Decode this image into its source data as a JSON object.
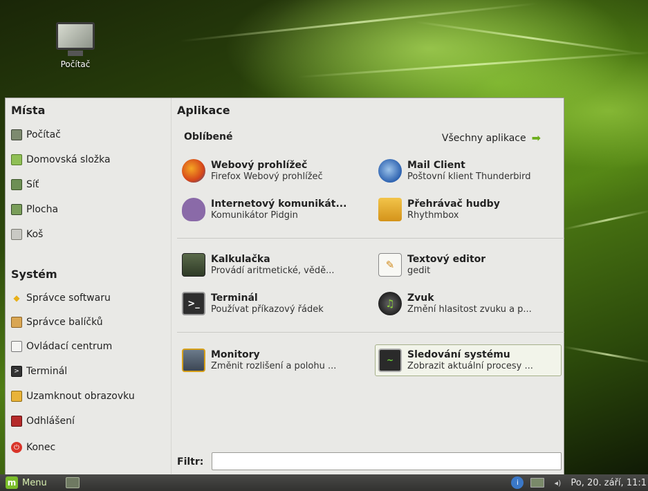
{
  "desktop": {
    "icon_label": "Počítač"
  },
  "places": {
    "title": "Místa",
    "items": [
      {
        "label": "Počítač",
        "icon": "computer-icon"
      },
      {
        "label": "Domovská složka",
        "icon": "home-folder-icon"
      },
      {
        "label": "Síť",
        "icon": "network-icon"
      },
      {
        "label": "Plocha",
        "icon": "desktop-icon"
      },
      {
        "label": "Koš",
        "icon": "trash-icon"
      }
    ]
  },
  "system": {
    "title": "Systém",
    "items": [
      {
        "label": "Správce softwaru",
        "icon": "software-manager-icon"
      },
      {
        "label": "Správce balíčků",
        "icon": "package-manager-icon"
      },
      {
        "label": "Ovládací centrum",
        "icon": "control-center-icon"
      },
      {
        "label": "Terminál",
        "icon": "terminal-icon"
      },
      {
        "label": "Uzamknout obrazovku",
        "icon": "lock-screen-icon"
      },
      {
        "label": "Odhlášení",
        "icon": "logout-icon"
      },
      {
        "label": "Konec",
        "icon": "power-icon"
      }
    ]
  },
  "apps": {
    "title": "Aplikace",
    "favorites_title": "Oblíbené",
    "all_apps_label": "Všechny aplikace",
    "items": [
      {
        "name": "Webový prohlížeč",
        "desc": "Firefox Webový prohlížeč",
        "icon": "firefox-icon"
      },
      {
        "name": "Mail Client",
        "desc": "Poštovní klient Thunderbird",
        "icon": "thunderbird-icon"
      },
      {
        "name": "Internetový komunikát...",
        "desc": "Komunikátor Pidgin",
        "icon": "pidgin-icon"
      },
      {
        "name": "Přehrávač hudby",
        "desc": "Rhythmbox",
        "icon": "rhythmbox-icon"
      },
      {
        "name": "Kalkulačka",
        "desc": "Provádí aritmetické, vědě...",
        "icon": "calculator-icon"
      },
      {
        "name": "Textový editor",
        "desc": "gedit",
        "icon": "text-editor-icon"
      },
      {
        "name": "Terminál",
        "desc": "Používat příkazový řádek",
        "icon": "terminal-icon"
      },
      {
        "name": "Zvuk",
        "desc": "Změní hlasitost zvuku a p...",
        "icon": "sound-icon"
      },
      {
        "name": "Monitory",
        "desc": "Změnit rozlišení a polohu ...",
        "icon": "monitors-icon"
      },
      {
        "name": "Sledování systému",
        "desc": "Zobrazit aktuální procesy ...",
        "icon": "system-monitor-icon"
      }
    ]
  },
  "filter": {
    "label": "Filtr:",
    "value": ""
  },
  "taskbar": {
    "menu_label": "Menu",
    "clock": "Po, 20. září, 11:1"
  },
  "colors": {
    "accent": "#7bbd2a",
    "panel_bg": "#e9e9e6"
  }
}
